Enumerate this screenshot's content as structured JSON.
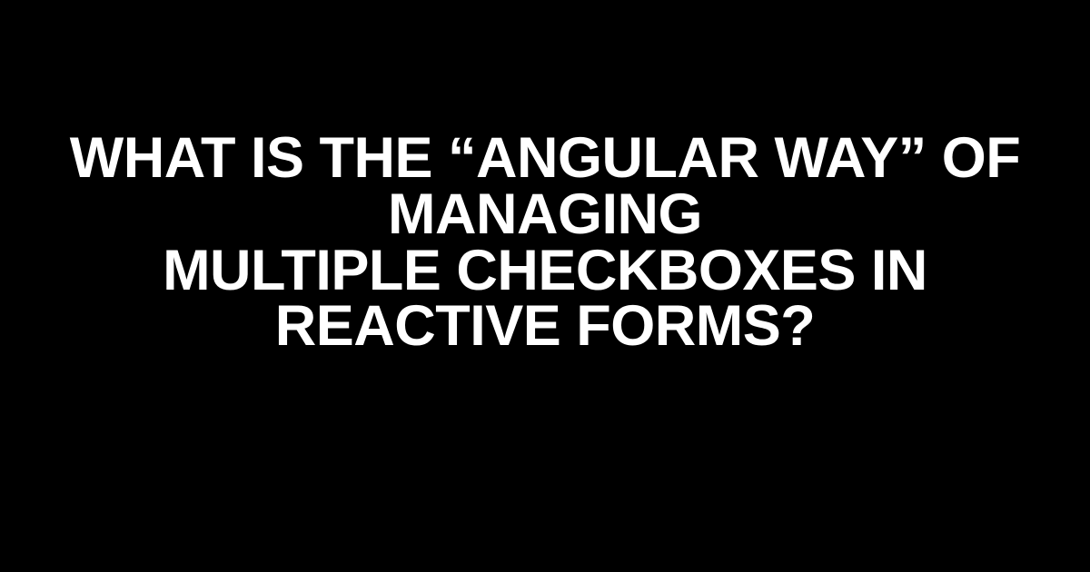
{
  "heading": {
    "line1": "WHAT IS THE “ANGULAR WAY” OF MANAGING",
    "line2": "MULTIPLE CHECKBOXES IN REACTIVE FORMS?"
  }
}
